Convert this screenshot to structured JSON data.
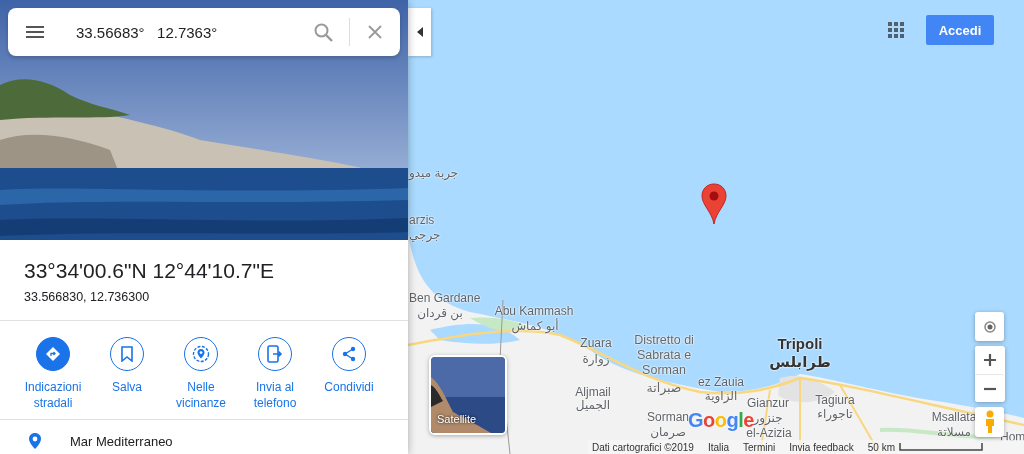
{
  "search": {
    "value": "33.56683°   12.7363°"
  },
  "place": {
    "title": "33°34'00.6\"N 12°44'10.7\"E",
    "coords": "33.566830, 12.736300"
  },
  "actions": [
    {
      "kind": "directions",
      "label": "Indicazioni stradali",
      "primary": true
    },
    {
      "kind": "save",
      "label": "Salva",
      "primary": false
    },
    {
      "kind": "nearby",
      "label": "Nelle vicinanze",
      "primary": false
    },
    {
      "kind": "send",
      "label": "Invia al telefono",
      "primary": false
    },
    {
      "kind": "share",
      "label": "Condividi",
      "primary": false
    }
  ],
  "nearby_row": {
    "label": "Mar Mediterraneo"
  },
  "top_bar": {
    "sign_in": "Accedi"
  },
  "map": {
    "labels": [
      {
        "text": "جربة ميدو",
        "kind": "place"
      },
      {
        "text": "arzis",
        "kind": "place"
      },
      {
        "text": "جرجي",
        "kind": "place"
      },
      {
        "text": "Ben Gardane",
        "kind": "place"
      },
      {
        "text": "بن قردان",
        "kind": "place"
      },
      {
        "text": "Abu Kammash",
        "kind": "place"
      },
      {
        "text": "أبو كماش",
        "kind": "place"
      },
      {
        "text": "Zuara",
        "kind": "place"
      },
      {
        "text": "زوارة",
        "kind": "place"
      },
      {
        "text": "Aljmail",
        "kind": "place"
      },
      {
        "text": "الجميل",
        "kind": "place"
      },
      {
        "text": "Distretto di Sabrata e Sorman",
        "kind": "region"
      },
      {
        "text": "صبراتة",
        "kind": "region"
      },
      {
        "text": "ez Zauia",
        "kind": "place"
      },
      {
        "text": "الزاوية",
        "kind": "place"
      },
      {
        "text": "Tripoli",
        "kind": "capital"
      },
      {
        "text": "طرابلس",
        "kind": "capital"
      },
      {
        "text": "Gianzur",
        "kind": "place"
      },
      {
        "text": "جنزور",
        "kind": "place"
      },
      {
        "text": "el-Azizia",
        "kind": "place"
      },
      {
        "text": "Sorman",
        "kind": "place"
      },
      {
        "text": "صرمان",
        "kind": "place"
      },
      {
        "text": "Tagiura",
        "kind": "place"
      },
      {
        "text": "تاجوراء",
        "kind": "place"
      },
      {
        "text": "Msallata",
        "kind": "place"
      },
      {
        "text": "مسلاتة",
        "kind": "place"
      },
      {
        "text": "Hom",
        "kind": "place"
      }
    ],
    "satellite_label": "Satellite",
    "logo": "Google",
    "footer": [
      "Dati cartografici ©2019",
      "Italia",
      "Termini",
      "Invia feedback"
    ],
    "scale": "50 km"
  }
}
